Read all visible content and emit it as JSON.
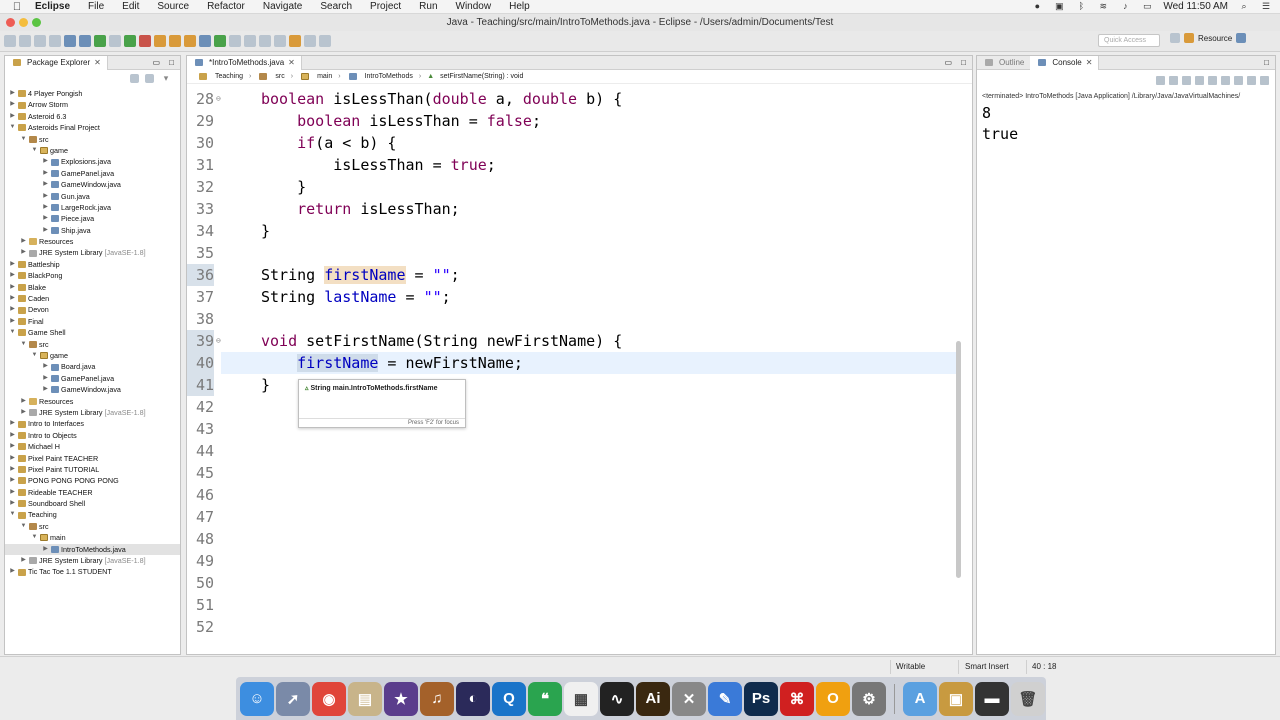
{
  "menubar": {
    "app": "Eclipse",
    "items": [
      "File",
      "Edit",
      "Source",
      "Refactor",
      "Navigate",
      "Search",
      "Project",
      "Run",
      "Window",
      "Help"
    ],
    "clock": "Wed 11:50 AM"
  },
  "window": {
    "title": "Java - Teaching/src/main/IntroToMethods.java - Eclipse - /Users/admin/Documents/Test"
  },
  "toolbar": {
    "quick_access": "Quick Access",
    "perspective": "Resource"
  },
  "explorer": {
    "tab_label": "Package Explorer",
    "tree": [
      {
        "label": "4 Player Pongish",
        "indent": 0,
        "kind": "proj",
        "tw": "▶"
      },
      {
        "label": "Arrow Storm",
        "indent": 0,
        "kind": "proj",
        "tw": "▶"
      },
      {
        "label": "Asteroid 6.3",
        "indent": 0,
        "kind": "proj",
        "tw": "▶"
      },
      {
        "label": "Asteroids Final Project",
        "indent": 0,
        "kind": "proj",
        "tw": "▼"
      },
      {
        "label": "src",
        "indent": 1,
        "kind": "src",
        "tw": "▼"
      },
      {
        "label": "game",
        "indent": 2,
        "kind": "pkg",
        "tw": "▼"
      },
      {
        "label": "Explosions.java",
        "indent": 3,
        "kind": "java",
        "tw": "▶"
      },
      {
        "label": "GamePanel.java",
        "indent": 3,
        "kind": "java",
        "tw": "▶"
      },
      {
        "label": "GameWindow.java",
        "indent": 3,
        "kind": "java",
        "tw": "▶"
      },
      {
        "label": "Gun.java",
        "indent": 3,
        "kind": "java",
        "tw": "▶"
      },
      {
        "label": "LargeRock.java",
        "indent": 3,
        "kind": "java",
        "tw": "▶"
      },
      {
        "label": "Piece.java",
        "indent": 3,
        "kind": "java",
        "tw": "▶"
      },
      {
        "label": "Ship.java",
        "indent": 3,
        "kind": "java",
        "tw": "▶"
      },
      {
        "label": "Resources",
        "indent": 1,
        "kind": "res",
        "tw": "▶"
      },
      {
        "label": "JRE System Library",
        "suffix": "[JavaSE-1.8]",
        "indent": 1,
        "kind": "lib",
        "tw": "▶"
      },
      {
        "label": "Battleship",
        "indent": 0,
        "kind": "proj",
        "tw": "▶"
      },
      {
        "label": "BlackPong",
        "indent": 0,
        "kind": "proj",
        "tw": "▶"
      },
      {
        "label": "Blake",
        "indent": 0,
        "kind": "proj",
        "tw": "▶"
      },
      {
        "label": "Caden",
        "indent": 0,
        "kind": "proj",
        "tw": "▶"
      },
      {
        "label": "Devon",
        "indent": 0,
        "kind": "proj",
        "tw": "▶"
      },
      {
        "label": "Final",
        "indent": 0,
        "kind": "proj",
        "tw": "▶"
      },
      {
        "label": "Game Shell",
        "indent": 0,
        "kind": "proj",
        "tw": "▼"
      },
      {
        "label": "src",
        "indent": 1,
        "kind": "src",
        "tw": "▼"
      },
      {
        "label": "game",
        "indent": 2,
        "kind": "pkg",
        "tw": "▼"
      },
      {
        "label": "Board.java",
        "indent": 3,
        "kind": "java",
        "tw": "▶"
      },
      {
        "label": "GamePanel.java",
        "indent": 3,
        "kind": "java",
        "tw": "▶"
      },
      {
        "label": "GameWindow.java",
        "indent": 3,
        "kind": "java",
        "tw": "▶"
      },
      {
        "label": "Resources",
        "indent": 1,
        "kind": "res",
        "tw": "▶"
      },
      {
        "label": "JRE System Library",
        "suffix": "[JavaSE-1.8]",
        "indent": 1,
        "kind": "lib",
        "tw": "▶"
      },
      {
        "label": "Intro to Interfaces",
        "indent": 0,
        "kind": "proj",
        "tw": "▶"
      },
      {
        "label": "Intro to Objects",
        "indent": 0,
        "kind": "proj",
        "tw": "▶"
      },
      {
        "label": "Michael H",
        "indent": 0,
        "kind": "proj",
        "tw": "▶"
      },
      {
        "label": "Pixel Paint TEACHER",
        "indent": 0,
        "kind": "proj",
        "tw": "▶"
      },
      {
        "label": "Pixel Paint TUTORIAL",
        "indent": 0,
        "kind": "proj",
        "tw": "▶"
      },
      {
        "label": "PONG PONG PONG PONG",
        "indent": 0,
        "kind": "proj",
        "tw": "▶"
      },
      {
        "label": "Rideable TEACHER",
        "indent": 0,
        "kind": "proj",
        "tw": "▶"
      },
      {
        "label": "Soundboard Shell",
        "indent": 0,
        "kind": "proj",
        "tw": "▶"
      },
      {
        "label": "Teaching",
        "indent": 0,
        "kind": "proj",
        "tw": "▼"
      },
      {
        "label": "src",
        "indent": 1,
        "kind": "src",
        "tw": "▼"
      },
      {
        "label": "main",
        "indent": 2,
        "kind": "pkg",
        "tw": "▼"
      },
      {
        "label": "IntroToMethods.java",
        "indent": 3,
        "kind": "java",
        "tw": "▶",
        "selected": true
      },
      {
        "label": "JRE System Library",
        "suffix": "[JavaSE-1.8]",
        "indent": 1,
        "kind": "lib",
        "tw": "▶"
      },
      {
        "label": "Tic Tac Toe 1.1 STUDENT",
        "indent": 0,
        "kind": "proj",
        "tw": "▶"
      }
    ]
  },
  "editor": {
    "tab_label": "*IntroToMethods.java",
    "breadcrumb": [
      "Teaching",
      "src",
      "main",
      "IntroToMethods",
      "setFirstName(String) : void"
    ],
    "lines": [
      {
        "n": "28",
        "fold": true,
        "html": "<span class=\"kw\">boolean</span> isLessThan(<span class=\"kw\">double</span> a, <span class=\"kw\">double</span> b) {"
      },
      {
        "n": "29",
        "html": "    <span class=\"kw\">boolean</span> isLessThan = <span class=\"kw\">false</span>;"
      },
      {
        "n": "30",
        "html": "    <span class=\"kw\">if</span>(a &lt; b) {"
      },
      {
        "n": "31",
        "html": "        isLessThan = <span class=\"kw\">true</span>;"
      },
      {
        "n": "32",
        "html": "    }"
      },
      {
        "n": "33",
        "html": "    <span class=\"kw\">return</span> isLessThan;"
      },
      {
        "n": "34",
        "html": "}"
      },
      {
        "n": "35",
        "html": ""
      },
      {
        "n": "36",
        "mark": true,
        "html": "String <span class=\"fld hl\">firstName</span> = <span class=\"str\">\"\"</span>;"
      },
      {
        "n": "37",
        "html": "String <span class=\"fld\">lastName</span> = <span class=\"str\">\"\"</span>;"
      },
      {
        "n": "38",
        "html": ""
      },
      {
        "n": "39",
        "fold": true,
        "mark": true,
        "html": "<span class=\"kw\">void</span> setFirstName(String newFirstName) {"
      },
      {
        "n": "40",
        "mark": true,
        "current": true,
        "html": "    <span class=\"fld hl2\">firstName</span> = newFirstName;"
      },
      {
        "n": "41",
        "mark": true,
        "html": "}"
      },
      {
        "n": "42",
        "html": ""
      },
      {
        "n": "43",
        "html": ""
      },
      {
        "n": "44",
        "html": ""
      },
      {
        "n": "45",
        "html": ""
      },
      {
        "n": "46",
        "html": ""
      },
      {
        "n": "47",
        "html": ""
      },
      {
        "n": "48",
        "html": ""
      },
      {
        "n": "49",
        "html": ""
      },
      {
        "n": "50",
        "html": ""
      },
      {
        "n": "51",
        "html": ""
      },
      {
        "n": "52",
        "html": ""
      }
    ],
    "tooltip": {
      "text": "String main.IntroToMethods.firstName",
      "footer": "Press 'F2' for focus"
    }
  },
  "right_panel": {
    "tabs": [
      "Outline",
      "Console"
    ],
    "console_header": "<terminated> IntroToMethods [Java Application] /Library/Java/JavaVirtualMachines/",
    "output": [
      "8",
      "true"
    ]
  },
  "status": {
    "mode": "Writable",
    "insert": "Smart Insert",
    "position": "40 : 18"
  },
  "dock": [
    {
      "name": "finder",
      "color": "#3d8ee0",
      "glyph": "☺"
    },
    {
      "name": "launchpad",
      "color": "#7a8aa8",
      "glyph": "➚"
    },
    {
      "name": "chrome",
      "color": "#e0453a",
      "glyph": "◉"
    },
    {
      "name": "notes",
      "color": "#c8b48a",
      "glyph": "▤"
    },
    {
      "name": "imovie",
      "color": "#5a3d8c",
      "glyph": "★"
    },
    {
      "name": "garageband",
      "color": "#a4612a",
      "glyph": "♫"
    },
    {
      "name": "eclipse",
      "color": "#2b2a5a",
      "glyph": "◐"
    },
    {
      "name": "quicktime",
      "color": "#1a74c9",
      "glyph": "Q"
    },
    {
      "name": "hangouts",
      "color": "#2aa44f",
      "glyph": "❝"
    },
    {
      "name": "grid-app",
      "color": "#f0f0f0",
      "glyph": "▦"
    },
    {
      "name": "activity-monitor",
      "color": "#222",
      "glyph": "∿"
    },
    {
      "name": "illustrator",
      "color": "#3a2810",
      "glyph": "Ai"
    },
    {
      "name": "utilities",
      "color": "#888",
      "glyph": "✕"
    },
    {
      "name": "textedit",
      "color": "#3a7ad8",
      "glyph": "✎"
    },
    {
      "name": "photoshop",
      "color": "#0f2b4c",
      "glyph": "Ps"
    },
    {
      "name": "acrobat",
      "color": "#d02020",
      "glyph": "⌘"
    },
    {
      "name": "opera",
      "color": "#f0a010",
      "glyph": "O"
    },
    {
      "name": "system-preferences",
      "color": "#777",
      "glyph": "⚙"
    },
    {
      "name": "applications-folder",
      "color": "#5aa0e0",
      "glyph": "A"
    },
    {
      "name": "archive",
      "color": "#c89a40",
      "glyph": "▣"
    },
    {
      "name": "terminal",
      "color": "#333",
      "glyph": "▬"
    },
    {
      "name": "trash",
      "color": "#d0d0d0",
      "glyph": "🗑"
    }
  ]
}
